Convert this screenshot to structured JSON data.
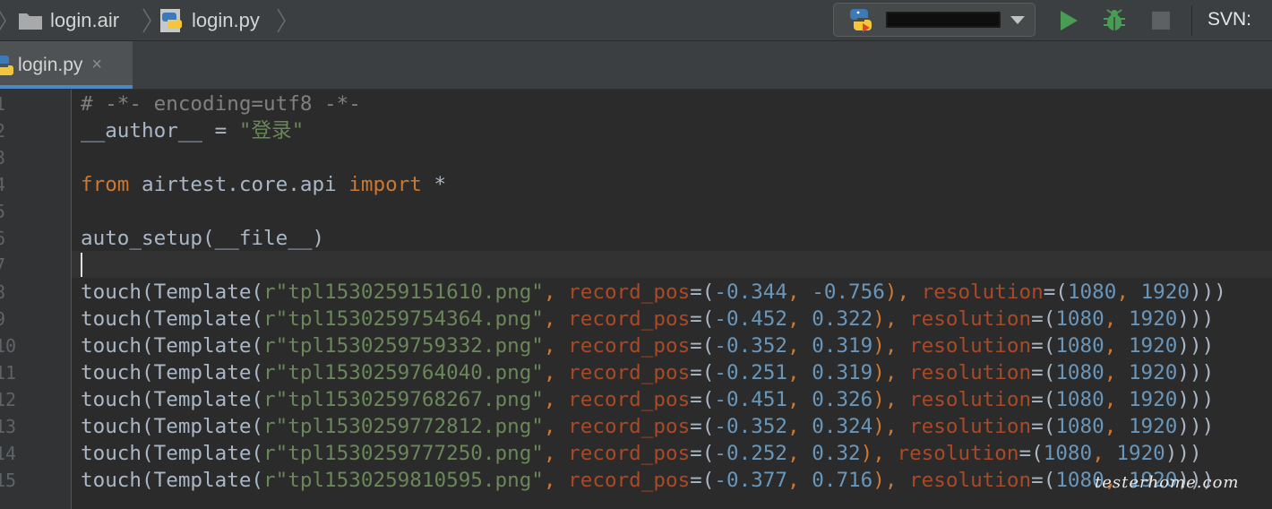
{
  "breadcrumbs": [
    {
      "label": "login.air",
      "icon": "folder-icon"
    },
    {
      "label": "login.py",
      "icon": "python-file-icon"
    }
  ],
  "toolbar": {
    "run_config": {
      "icon": "python-icon",
      "name": "[redacted]"
    },
    "run_icon": "run-icon",
    "debug_icon": "debug-icon",
    "stop_icon": "stop-icon",
    "svn_label": "SVN:"
  },
  "tabs": [
    {
      "label": "login.py",
      "close": "×",
      "active": true
    }
  ],
  "editor": {
    "line_numbers": [
      "1",
      "2",
      "3",
      "4",
      "5",
      "6",
      "7",
      "8",
      "9",
      "10",
      "11",
      "12",
      "13",
      "14",
      "15"
    ],
    "caret_line": 7,
    "lines": [
      [
        {
          "t": "# -*- encoding=utf8 -*-",
          "k": "comment"
        }
      ],
      [
        {
          "t": "__author__",
          "k": "plain"
        },
        {
          "t": " = ",
          "k": "plain"
        },
        {
          "t": "\"登录\"",
          "k": "str"
        }
      ],
      [],
      [
        {
          "t": "from",
          "k": "kw"
        },
        {
          "t": " airtest.core.api ",
          "k": "plain"
        },
        {
          "t": "import",
          "k": "kw"
        },
        {
          "t": " *",
          "k": "plain"
        }
      ],
      [],
      [
        {
          "t": "auto_setup(__file__)",
          "k": "plain"
        }
      ],
      [],
      [
        {
          "t": "touch(Template(",
          "k": "plain"
        },
        {
          "t": "r\"tpl1530259151610.png\"",
          "k": "str"
        },
        {
          "t": ", ",
          "k": "kw"
        },
        {
          "t": "record_pos",
          "k": "param"
        },
        {
          "t": "=(",
          "k": "plain"
        },
        {
          "t": "-0.344",
          "k": "num"
        },
        {
          "t": ", ",
          "k": "kw"
        },
        {
          "t": "-0.756",
          "k": "num"
        },
        {
          "t": "), ",
          "k": "kw"
        },
        {
          "t": "resolution",
          "k": "param"
        },
        {
          "t": "=(",
          "k": "plain"
        },
        {
          "t": "1080",
          "k": "num"
        },
        {
          "t": ", ",
          "k": "kw"
        },
        {
          "t": "1920",
          "k": "num"
        },
        {
          "t": ")))",
          "k": "plain"
        }
      ],
      [
        {
          "t": "touch(Template(",
          "k": "plain"
        },
        {
          "t": "r\"tpl1530259754364.png\"",
          "k": "str"
        },
        {
          "t": ", ",
          "k": "kw"
        },
        {
          "t": "record_pos",
          "k": "param"
        },
        {
          "t": "=(",
          "k": "plain"
        },
        {
          "t": "-0.452",
          "k": "num"
        },
        {
          "t": ", ",
          "k": "kw"
        },
        {
          "t": "0.322",
          "k": "num"
        },
        {
          "t": "), ",
          "k": "kw"
        },
        {
          "t": "resolution",
          "k": "param"
        },
        {
          "t": "=(",
          "k": "plain"
        },
        {
          "t": "1080",
          "k": "num"
        },
        {
          "t": ", ",
          "k": "kw"
        },
        {
          "t": "1920",
          "k": "num"
        },
        {
          "t": ")))",
          "k": "plain"
        }
      ],
      [
        {
          "t": "touch(Template(",
          "k": "plain"
        },
        {
          "t": "r\"tpl1530259759332.png\"",
          "k": "str"
        },
        {
          "t": ", ",
          "k": "kw"
        },
        {
          "t": "record_pos",
          "k": "param"
        },
        {
          "t": "=(",
          "k": "plain"
        },
        {
          "t": "-0.352",
          "k": "num"
        },
        {
          "t": ", ",
          "k": "kw"
        },
        {
          "t": "0.319",
          "k": "num"
        },
        {
          "t": "), ",
          "k": "kw"
        },
        {
          "t": "resolution",
          "k": "param"
        },
        {
          "t": "=(",
          "k": "plain"
        },
        {
          "t": "1080",
          "k": "num"
        },
        {
          "t": ", ",
          "k": "kw"
        },
        {
          "t": "1920",
          "k": "num"
        },
        {
          "t": ")))",
          "k": "plain"
        }
      ],
      [
        {
          "t": "touch(Template(",
          "k": "plain"
        },
        {
          "t": "r\"tpl1530259764040.png\"",
          "k": "str"
        },
        {
          "t": ", ",
          "k": "kw"
        },
        {
          "t": "record_pos",
          "k": "param"
        },
        {
          "t": "=(",
          "k": "plain"
        },
        {
          "t": "-0.251",
          "k": "num"
        },
        {
          "t": ", ",
          "k": "kw"
        },
        {
          "t": "0.319",
          "k": "num"
        },
        {
          "t": "), ",
          "k": "kw"
        },
        {
          "t": "resolution",
          "k": "param"
        },
        {
          "t": "=(",
          "k": "plain"
        },
        {
          "t": "1080",
          "k": "num"
        },
        {
          "t": ", ",
          "k": "kw"
        },
        {
          "t": "1920",
          "k": "num"
        },
        {
          "t": ")))",
          "k": "plain"
        }
      ],
      [
        {
          "t": "touch(Template(",
          "k": "plain"
        },
        {
          "t": "r\"tpl1530259768267.png\"",
          "k": "str"
        },
        {
          "t": ", ",
          "k": "kw"
        },
        {
          "t": "record_pos",
          "k": "param"
        },
        {
          "t": "=(",
          "k": "plain"
        },
        {
          "t": "-0.451",
          "k": "num"
        },
        {
          "t": ", ",
          "k": "kw"
        },
        {
          "t": "0.326",
          "k": "num"
        },
        {
          "t": "), ",
          "k": "kw"
        },
        {
          "t": "resolution",
          "k": "param"
        },
        {
          "t": "=(",
          "k": "plain"
        },
        {
          "t": "1080",
          "k": "num"
        },
        {
          "t": ", ",
          "k": "kw"
        },
        {
          "t": "1920",
          "k": "num"
        },
        {
          "t": ")))",
          "k": "plain"
        }
      ],
      [
        {
          "t": "touch(Template(",
          "k": "plain"
        },
        {
          "t": "r\"tpl1530259772812.png\"",
          "k": "str"
        },
        {
          "t": ", ",
          "k": "kw"
        },
        {
          "t": "record_pos",
          "k": "param"
        },
        {
          "t": "=(",
          "k": "plain"
        },
        {
          "t": "-0.352",
          "k": "num"
        },
        {
          "t": ", ",
          "k": "kw"
        },
        {
          "t": "0.324",
          "k": "num"
        },
        {
          "t": "), ",
          "k": "kw"
        },
        {
          "t": "resolution",
          "k": "param"
        },
        {
          "t": "=(",
          "k": "plain"
        },
        {
          "t": "1080",
          "k": "num"
        },
        {
          "t": ", ",
          "k": "kw"
        },
        {
          "t": "1920",
          "k": "num"
        },
        {
          "t": ")))",
          "k": "plain"
        }
      ],
      [
        {
          "t": "touch(Template(",
          "k": "plain"
        },
        {
          "t": "r\"tpl1530259777250.png\"",
          "k": "str"
        },
        {
          "t": ", ",
          "k": "kw"
        },
        {
          "t": "record_pos",
          "k": "param"
        },
        {
          "t": "=(",
          "k": "plain"
        },
        {
          "t": "-0.252",
          "k": "num"
        },
        {
          "t": ", ",
          "k": "kw"
        },
        {
          "t": "0.32",
          "k": "num"
        },
        {
          "t": "), ",
          "k": "kw"
        },
        {
          "t": "resolution",
          "k": "param"
        },
        {
          "t": "=(",
          "k": "plain"
        },
        {
          "t": "1080",
          "k": "num"
        },
        {
          "t": ", ",
          "k": "kw"
        },
        {
          "t": "1920",
          "k": "num"
        },
        {
          "t": ")))",
          "k": "plain"
        }
      ],
      [
        {
          "t": "touch(Template(",
          "k": "plain"
        },
        {
          "t": "r\"tpl1530259810595.png\"",
          "k": "str"
        },
        {
          "t": ", ",
          "k": "kw"
        },
        {
          "t": "record_pos",
          "k": "param"
        },
        {
          "t": "=(",
          "k": "plain"
        },
        {
          "t": "-0.377",
          "k": "num"
        },
        {
          "t": ", ",
          "k": "kw"
        },
        {
          "t": "0.716",
          "k": "num"
        },
        {
          "t": "), ",
          "k": "kw"
        },
        {
          "t": "resolution",
          "k": "param"
        },
        {
          "t": "=(",
          "k": "plain"
        },
        {
          "t": "1080",
          "k": "num"
        },
        {
          "t": ", ",
          "k": "kw"
        },
        {
          "t": "1920",
          "k": "num"
        },
        {
          "t": ")))",
          "k": "plain"
        }
      ]
    ]
  },
  "watermark": "testerhome.com",
  "colors": {
    "background": "#2b2b2b",
    "keyword": "#cc7832",
    "string": "#6a8759",
    "number": "#6897bb",
    "parameter": "#aa4926",
    "comment": "#808080",
    "tab_accent": "#4a88c7",
    "run_green": "#499c54"
  }
}
